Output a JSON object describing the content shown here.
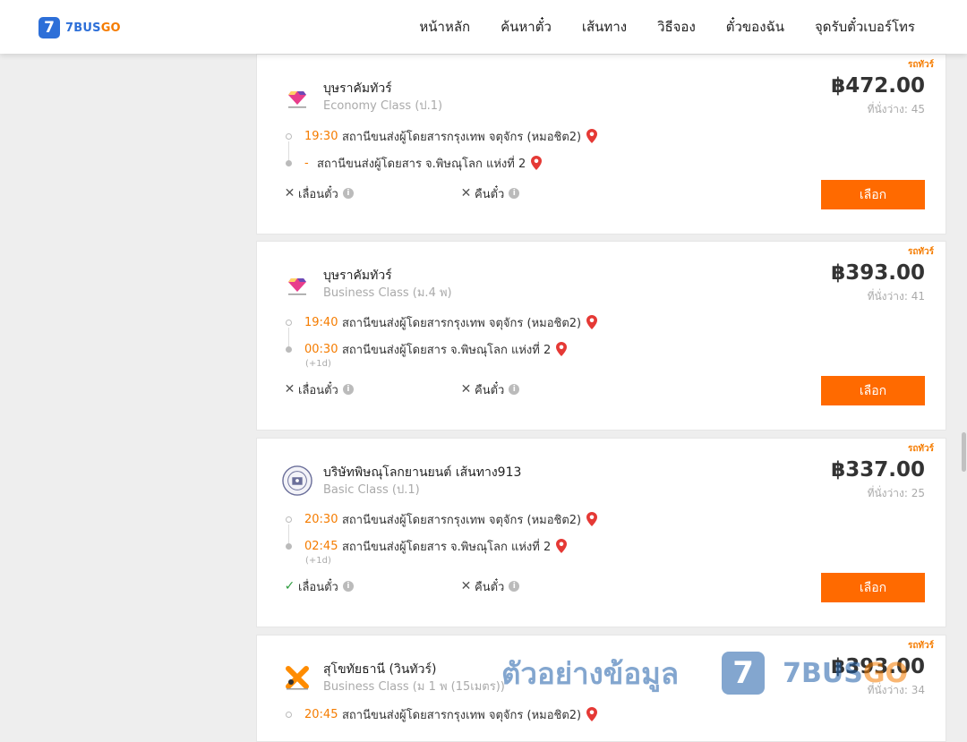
{
  "app": {
    "logo_digit": "7",
    "logo_main": "7BUS",
    "logo_go": "GO"
  },
  "nav": [
    "หน้าหลัก",
    "ค้นหาตั๋ว",
    "เส้นทาง",
    "วิธีจอง",
    "ตั๋วของฉัน",
    "จุดรับตั๋วเบอร์โทร"
  ],
  "colors": {
    "accent": "#ff6a00",
    "brand_blue": "#2d6fd8",
    "time_orange": "#f57c00",
    "pin_red": "#e53935"
  },
  "trips": [
    {
      "tag": "รถทัวร์",
      "operator": "บุษราคัมทัวร์",
      "class": "Economy Class (ป.1)",
      "price": "฿472.00",
      "seats": "ที่นั่งว่าง: 45",
      "depart_time": "19:30",
      "depart_station": "สถานีขนส่งผู้โดยสารกรุงเทพ จตุจักร (หมอชิต2)",
      "arrive_time": "-",
      "arrive_station": "สถานีขนส่งผู้โดยสาร จ.พิษณุโลก แห่งที่ 2",
      "next_day": "",
      "change_label": "เลื่อนตั๋ว",
      "change_allowed": false,
      "refund_label": "คืนตั๋ว",
      "refund_allowed": false,
      "select_label": "เลือก",
      "logo_icon": "diamond-logo-icon"
    },
    {
      "tag": "รถทัวร์",
      "operator": "บุษราคัมทัวร์",
      "class": "Business Class (ม.4 พ)",
      "price": "฿393.00",
      "seats": "ที่นั่งว่าง: 41",
      "depart_time": "19:40",
      "depart_station": "สถานีขนส่งผู้โดยสารกรุงเทพ จตุจักร (หมอชิต2)",
      "arrive_time": "00:30",
      "arrive_station": "สถานีขนส่งผู้โดยสาร จ.พิษณุโลก แห่งที่ 2",
      "next_day": "(+1d)",
      "change_label": "เลื่อนตั๋ว",
      "change_allowed": false,
      "refund_label": "คืนตั๋ว",
      "refund_allowed": false,
      "select_label": "เลือก",
      "logo_icon": "diamond-logo-icon"
    },
    {
      "tag": "รถทัวร์",
      "operator": "บริษัทพิษณุโลกยานยนต์ เส้นทาง913",
      "class": "Basic Class (ป.1)",
      "price": "฿337.00",
      "seats": "ที่นั่งว่าง: 25",
      "depart_time": "20:30",
      "depart_station": "สถานีขนส่งผู้โดยสารกรุงเทพ จตุจักร (หมอชิต2)",
      "arrive_time": "02:45",
      "arrive_station": "สถานีขนส่งผู้โดยสาร จ.พิษณุโลก แห่งที่ 2",
      "next_day": "(+1d)",
      "change_label": "เลื่อนตั๋ว",
      "change_allowed": true,
      "refund_label": "คืนตั๋ว",
      "refund_allowed": false,
      "select_label": "เลือก",
      "logo_icon": "seal-logo-icon"
    },
    {
      "tag": "รถทัวร์",
      "operator": "สุโขทัยธานี (วินทัวร์)",
      "class": "Business Class (ม 1 พ (15เมตร))",
      "price": "฿393.00",
      "seats": "ที่นั่งว่าง: 34",
      "depart_time": "20:45",
      "depart_station": "สถานีขนส่งผู้โดยสารกรุงเทพ จตุจักร (หมอชิต2)",
      "logo_icon": "win-tour-logo-icon"
    }
  ],
  "watermark": {
    "text": "ตัวอย่างข้อมูล",
    "badge": "7",
    "brand_main": "7BUS",
    "brand_go": "GO"
  }
}
